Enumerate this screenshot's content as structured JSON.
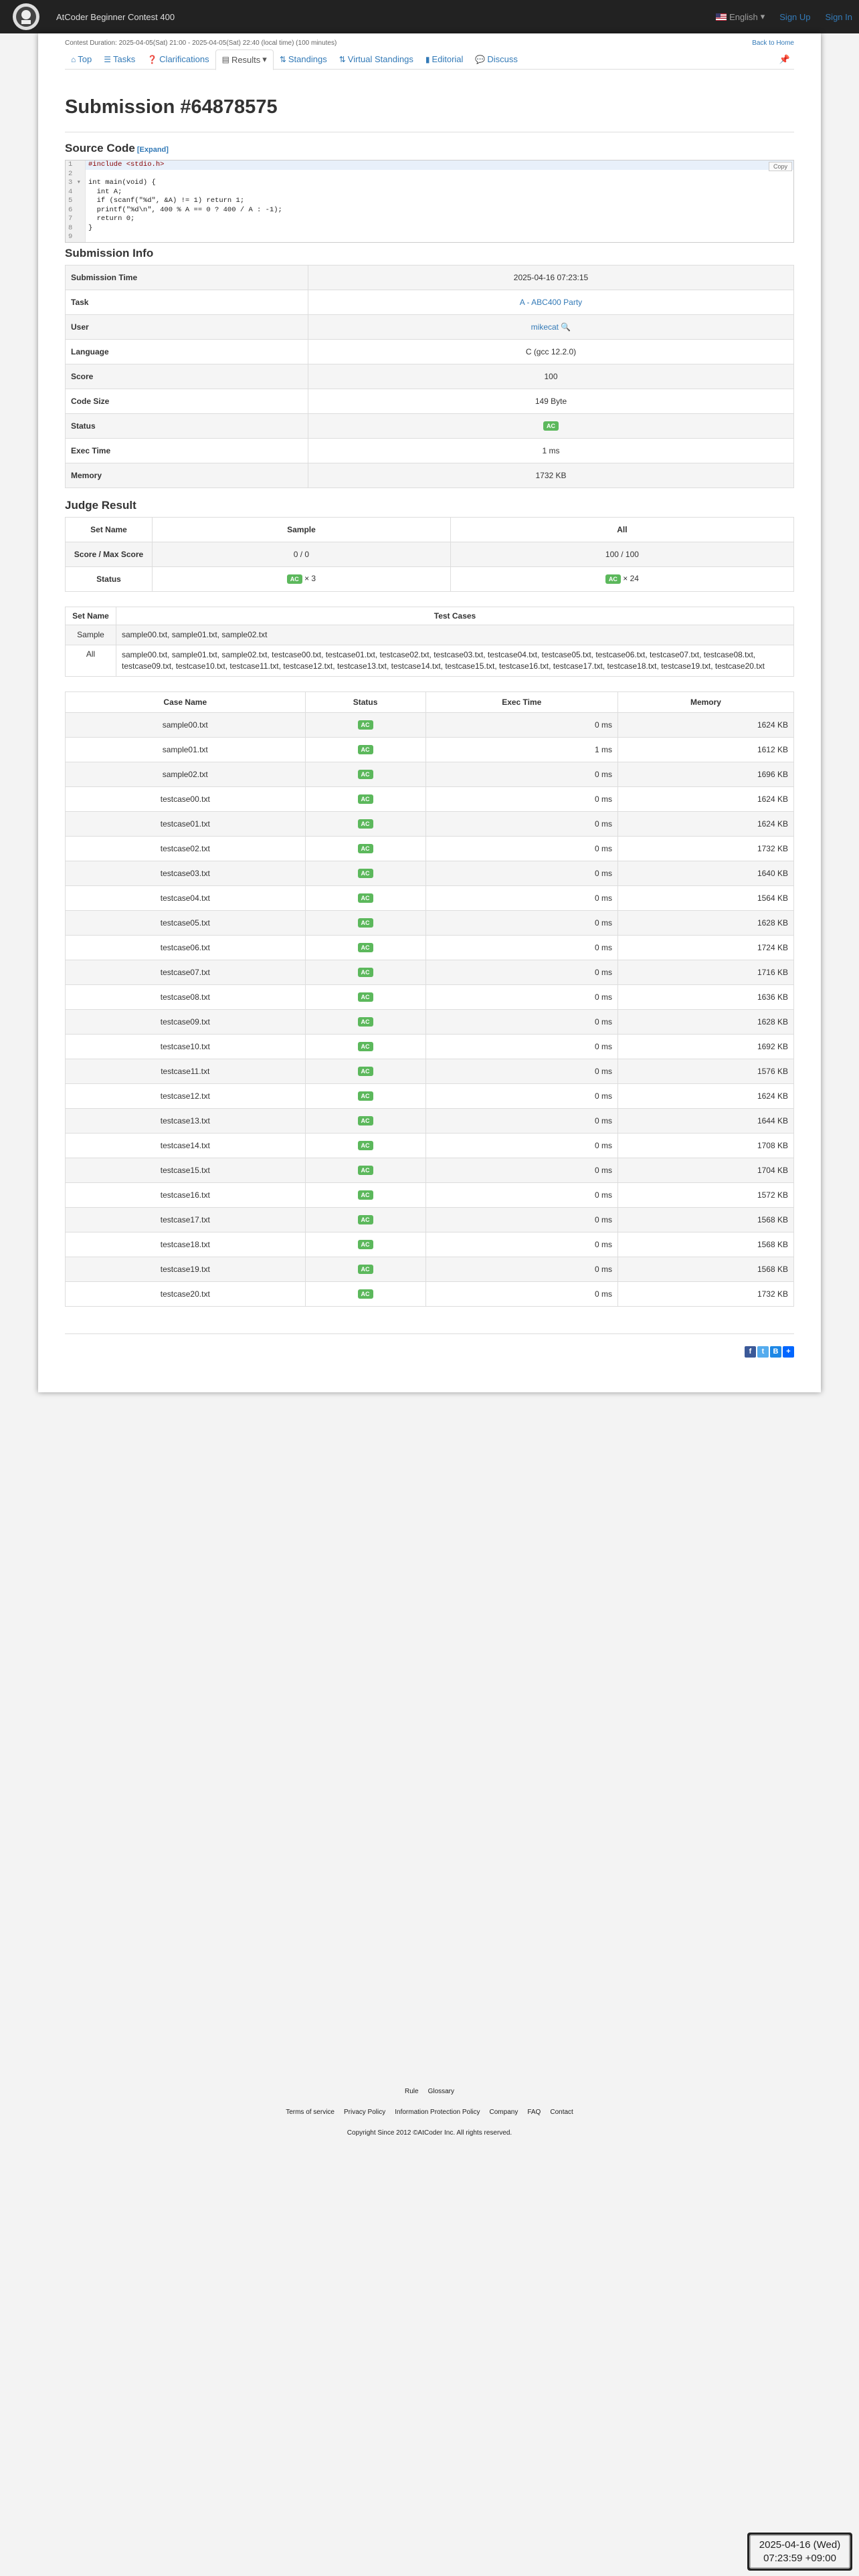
{
  "navbar": {
    "brand": "AtCoder Beginner Contest 400",
    "language": "English",
    "sign_up": "Sign Up",
    "sign_in": "Sign In"
  },
  "contest": {
    "duration": "Contest Duration: 2025-04-05(Sat) 21:00 - 2025-04-05(Sat) 22:40 (local time) (100 minutes)",
    "back_home": "Back to Home"
  },
  "tabs": [
    {
      "label": "Top",
      "icon": "home-icon"
    },
    {
      "label": "Tasks",
      "icon": "list-icon"
    },
    {
      "label": "Clarifications",
      "icon": "question-icon"
    },
    {
      "label": "Results",
      "icon": "table-icon"
    },
    {
      "label": "Standings",
      "icon": "sort-icon"
    },
    {
      "label": "Virtual Standings",
      "icon": "sort-icon"
    },
    {
      "label": "Editorial",
      "icon": "book-icon"
    },
    {
      "label": "Discuss",
      "icon": "comment-icon"
    }
  ],
  "title": "Submission #64878575",
  "source": {
    "heading": "Source Code",
    "expand": "[Expand]",
    "copy": "Copy",
    "lines": [
      "#include <stdio.h>",
      "",
      "int main(void) {",
      "  int A;",
      "  if (scanf(\"%d\", &A) != 1) return 1;",
      "  printf(\"%d\\n\", 400 % A == 0 ? 400 / A : -1);",
      "  return 0;",
      "}",
      ""
    ]
  },
  "info": {
    "heading": "Submission Info",
    "rows": [
      {
        "label": "Submission Time",
        "value": "2025-04-16 07:23:15"
      },
      {
        "label": "Task",
        "value": "A - ABC400 Party"
      },
      {
        "label": "User",
        "value": "mikecat"
      },
      {
        "label": "Language",
        "value": "C (gcc 12.2.0)"
      },
      {
        "label": "Score",
        "value": "100"
      },
      {
        "label": "Code Size",
        "value": "149 Byte"
      },
      {
        "label": "Status",
        "value": "AC"
      },
      {
        "label": "Exec Time",
        "value": "1 ms"
      },
      {
        "label": "Memory",
        "value": "1732 KB"
      }
    ]
  },
  "judge": {
    "heading": "Judge Result",
    "col_set": "Set Name",
    "col_sample": "Sample",
    "col_all": "All",
    "score_label": "Score / Max Score",
    "sample_score": "0 / 0",
    "all_score": "100 / 100",
    "status_label": "Status",
    "sample_status": "AC",
    "sample_count": "× 3",
    "all_status": "AC",
    "all_count": "× 24"
  },
  "sets": {
    "col_name": "Set Name",
    "col_cases": "Test Cases",
    "rows": [
      {
        "name": "Sample",
        "cases": "sample00.txt, sample01.txt, sample02.txt"
      },
      {
        "name": "All",
        "cases": "sample00.txt, sample01.txt, sample02.txt, testcase00.txt, testcase01.txt, testcase02.txt, testcase03.txt, testcase04.txt, testcase05.txt, testcase06.txt, testcase07.txt, testcase08.txt, testcase09.txt, testcase10.txt, testcase11.txt, testcase12.txt, testcase13.txt, testcase14.txt, testcase15.txt, testcase16.txt, testcase17.txt, testcase18.txt, testcase19.txt, testcase20.txt"
      }
    ]
  },
  "cases": {
    "col_name": "Case Name",
    "col_status": "Status",
    "col_time": "Exec Time",
    "col_memory": "Memory",
    "rows": [
      {
        "name": "sample00.txt",
        "status": "AC",
        "time": "0 ms",
        "memory": "1624 KB"
      },
      {
        "name": "sample01.txt",
        "status": "AC",
        "time": "1 ms",
        "memory": "1612 KB"
      },
      {
        "name": "sample02.txt",
        "status": "AC",
        "time": "0 ms",
        "memory": "1696 KB"
      },
      {
        "name": "testcase00.txt",
        "status": "AC",
        "time": "0 ms",
        "memory": "1624 KB"
      },
      {
        "name": "testcase01.txt",
        "status": "AC",
        "time": "0 ms",
        "memory": "1624 KB"
      },
      {
        "name": "testcase02.txt",
        "status": "AC",
        "time": "0 ms",
        "memory": "1732 KB"
      },
      {
        "name": "testcase03.txt",
        "status": "AC",
        "time": "0 ms",
        "memory": "1640 KB"
      },
      {
        "name": "testcase04.txt",
        "status": "AC",
        "time": "0 ms",
        "memory": "1564 KB"
      },
      {
        "name": "testcase05.txt",
        "status": "AC",
        "time": "0 ms",
        "memory": "1628 KB"
      },
      {
        "name": "testcase06.txt",
        "status": "AC",
        "time": "0 ms",
        "memory": "1724 KB"
      },
      {
        "name": "testcase07.txt",
        "status": "AC",
        "time": "0 ms",
        "memory": "1716 KB"
      },
      {
        "name": "testcase08.txt",
        "status": "AC",
        "time": "0 ms",
        "memory": "1636 KB"
      },
      {
        "name": "testcase09.txt",
        "status": "AC",
        "time": "0 ms",
        "memory": "1628 KB"
      },
      {
        "name": "testcase10.txt",
        "status": "AC",
        "time": "0 ms",
        "memory": "1692 KB"
      },
      {
        "name": "testcase11.txt",
        "status": "AC",
        "time": "0 ms",
        "memory": "1576 KB"
      },
      {
        "name": "testcase12.txt",
        "status": "AC",
        "time": "0 ms",
        "memory": "1624 KB"
      },
      {
        "name": "testcase13.txt",
        "status": "AC",
        "time": "0 ms",
        "memory": "1644 KB"
      },
      {
        "name": "testcase14.txt",
        "status": "AC",
        "time": "0 ms",
        "memory": "1708 KB"
      },
      {
        "name": "testcase15.txt",
        "status": "AC",
        "time": "0 ms",
        "memory": "1704 KB"
      },
      {
        "name": "testcase16.txt",
        "status": "AC",
        "time": "0 ms",
        "memory": "1572 KB"
      },
      {
        "name": "testcase17.txt",
        "status": "AC",
        "time": "0 ms",
        "memory": "1568 KB"
      },
      {
        "name": "testcase18.txt",
        "status": "AC",
        "time": "0 ms",
        "memory": "1568 KB"
      },
      {
        "name": "testcase19.txt",
        "status": "AC",
        "time": "0 ms",
        "memory": "1568 KB"
      },
      {
        "name": "testcase20.txt",
        "status": "AC",
        "time": "0 ms",
        "memory": "1732 KB"
      }
    ]
  },
  "footer": {
    "links1": [
      "Rule",
      "Glossary"
    ],
    "links2": [
      "Terms of service",
      "Privacy Policy",
      "Information Protection Policy",
      "Company",
      "FAQ",
      "Contact"
    ],
    "copyright": "Copyright Since 2012 ©AtCoder Inc. All rights reserved."
  },
  "clock": {
    "date": "2025-04-16 (Wed)",
    "time": "07:23:59 +09:00"
  },
  "colors": {
    "navbar": "#222222",
    "link": "#337ab7",
    "ac_badge": "#5cb85c"
  }
}
